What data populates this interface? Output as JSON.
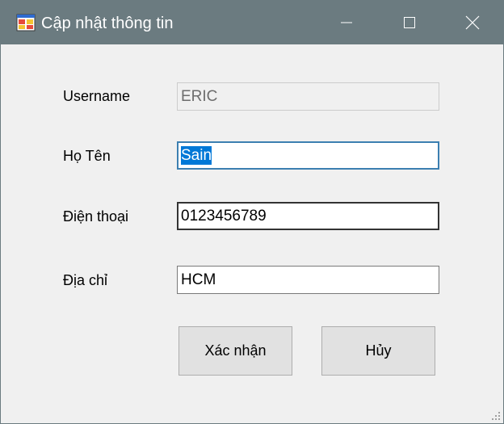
{
  "window": {
    "title": "Cập nhật thông tin",
    "icon": "winforms-app-icon",
    "controls": {
      "minimize": "minimize-icon",
      "maximize": "maximize-icon",
      "close": "close-icon"
    }
  },
  "form": {
    "username": {
      "label": "Username",
      "value": "ERIC",
      "readonly": true
    },
    "fullname": {
      "label": "Họ Tên",
      "value": "Sain",
      "selected": true
    },
    "phone": {
      "label": "Điện thoại",
      "value": "0123456789"
    },
    "address": {
      "label": "Địa chỉ",
      "value": "HCM"
    }
  },
  "buttons": {
    "confirm": "Xác nhận",
    "cancel": "Hủy"
  },
  "colors": {
    "titlebar": "#6b7b80",
    "window_bg": "#f0f0f0",
    "selection": "#0078d7",
    "focus_border": "#3c7fb1"
  }
}
